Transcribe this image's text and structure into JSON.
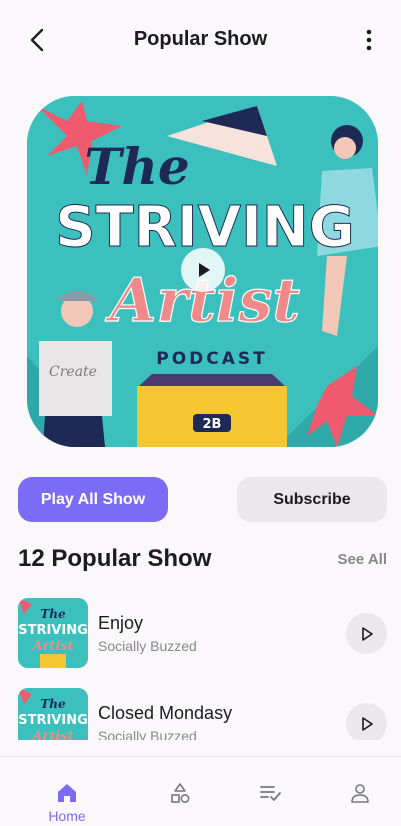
{
  "header": {
    "title": "Popular Show"
  },
  "cover": {
    "art_text": [
      "The",
      "STRIVING",
      "Artist",
      "PODCAST",
      "Create",
      "2B"
    ]
  },
  "actions": {
    "play_all_label": "Play All Show",
    "subscribe_label": "Subscribe"
  },
  "section": {
    "title": "12 Popular Show",
    "see_all_label": "See All"
  },
  "list": [
    {
      "title": "Enjoy",
      "subtitle": "Socially Buzzed",
      "icon": "play-icon"
    },
    {
      "title": "Closed Mondasy",
      "subtitle": "Socially Buzzed",
      "icon": "play-icon"
    }
  ],
  "tabbar": {
    "items": [
      {
        "label": "Home",
        "icon": "home-icon",
        "active": true
      },
      {
        "label": "",
        "icon": "shapes-icon",
        "active": false
      },
      {
        "label": "",
        "icon": "playlist-check-icon",
        "active": false
      },
      {
        "label": "",
        "icon": "profile-icon",
        "active": false
      }
    ]
  },
  "colors": {
    "accent": "#7c6cf5",
    "muted": "#8a868c",
    "cover_bg": "#3cc0be"
  }
}
